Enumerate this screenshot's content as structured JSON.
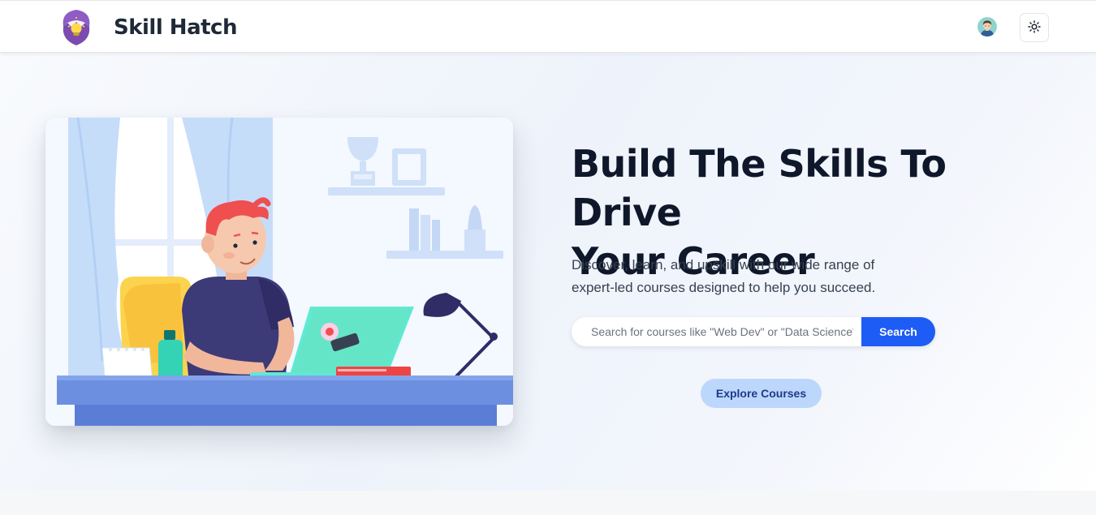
{
  "navbar": {
    "brand": "Skill Hatch",
    "logo_icon": "hatching-egg-lightbulb-icon",
    "avatar_icon": "user-avatar-icon",
    "theme_toggle_icon": "sun-icon"
  },
  "hero": {
    "headline_line1": "Build The Skills To Drive",
    "headline_line2": "Your Career",
    "subtext_line1": "Discover, learn, and upskill with our wide range of",
    "subtext_line2": "expert-led courses designed to help you succeed.",
    "search": {
      "placeholder": "Search for courses like \"Web Dev\" or \"Data Science\"",
      "value": "",
      "button_label": "Search"
    },
    "explore_label": "Explore Courses",
    "illustration": "person-working-on-laptop-at-desk"
  },
  "colors": {
    "primary": "#1d5cf5",
    "explore_bg": "#bcd7fb",
    "explore_text": "#1e3a8a",
    "heading": "#0f172a",
    "brand_purple": "#6b3fa0"
  }
}
